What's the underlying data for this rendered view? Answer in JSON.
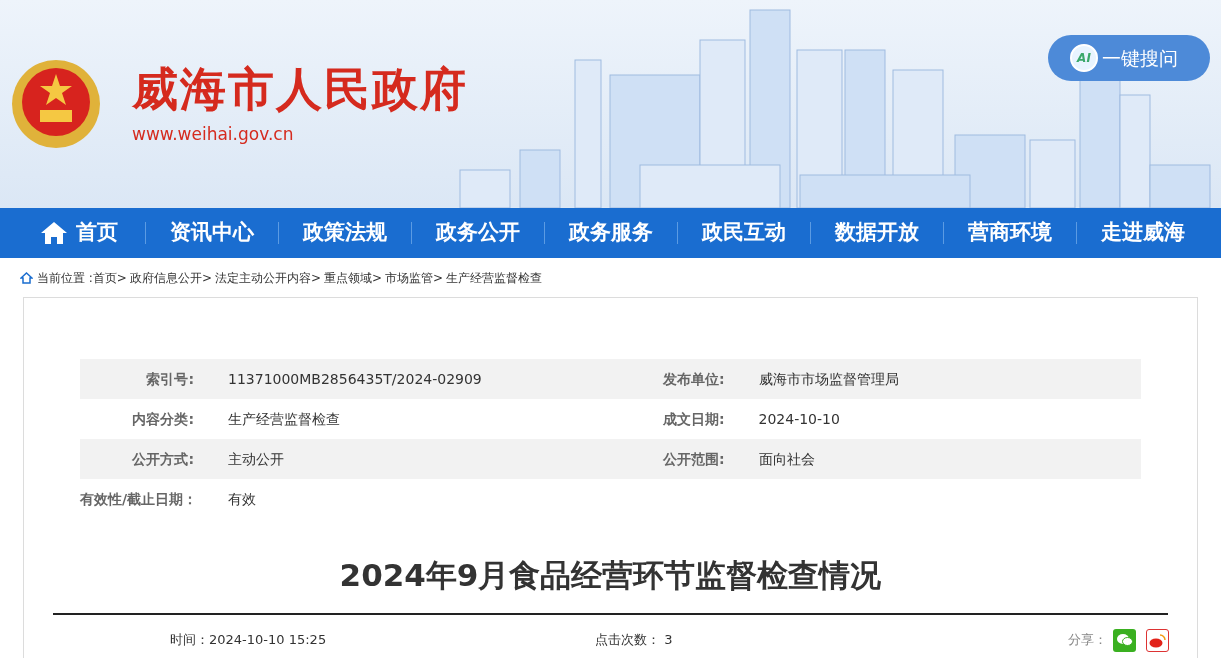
{
  "header": {
    "site_title": "威海市人民政府",
    "site_url": "www.weihai.gov.cn",
    "ai_button": {
      "badge": "AI",
      "label": "一键搜问"
    }
  },
  "nav": [
    {
      "label": "首页",
      "kind": "home"
    },
    {
      "label": "资讯中心",
      "kind": "plain"
    },
    {
      "label": "政策法规",
      "kind": "plain"
    },
    {
      "label": "政务公开",
      "kind": "plain"
    },
    {
      "label": "政务服务",
      "kind": "plain"
    },
    {
      "label": "政民互动",
      "kind": "plain"
    },
    {
      "label": "数据开放",
      "kind": "plain"
    },
    {
      "label": "营商环境",
      "kind": "plain"
    },
    {
      "label": "走进威海",
      "kind": "plain"
    }
  ],
  "breadcrumb": {
    "prefix": "当前位置 :",
    "separator": ">",
    "items": [
      "首页",
      "政府信息公开",
      "法定主动公开内容",
      "重点领域",
      "市场监管",
      "生产经营监督检查"
    ]
  },
  "meta": [
    {
      "cells": [
        {
          "label": "索引号:",
          "value": "11371000MB2856435T/2024-02909"
        },
        {
          "label": "发布单位:",
          "value": "威海市市场监督管理局"
        }
      ]
    },
    {
      "cells": [
        {
          "label": "内容分类:",
          "value": "生产经营监督检查"
        },
        {
          "label": "成文日期:",
          "value": "2024-10-10"
        }
      ]
    },
    {
      "cells": [
        {
          "label": "公开方式:",
          "value": "主动公开"
        },
        {
          "label": "公开范围:",
          "value": "面向社会"
        }
      ]
    },
    {
      "cells": [
        {
          "label": "有效性/截止日期：",
          "value": "有效"
        }
      ]
    }
  ],
  "article": {
    "title": "2024年9月食品经营环节监督检查情况",
    "time": "时间：2024-10-10 15:25",
    "clicks_label": "点击次数：",
    "clicks": "3",
    "share_label": "分享："
  }
}
